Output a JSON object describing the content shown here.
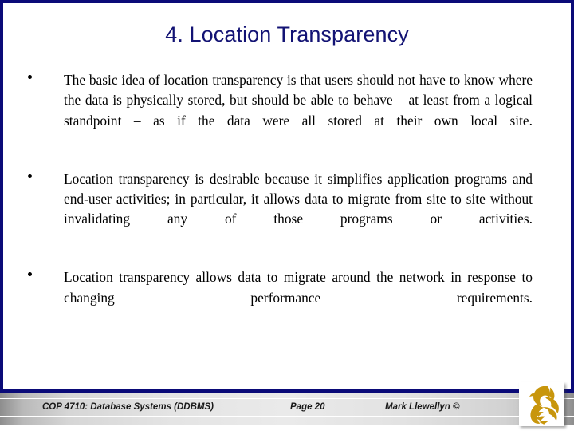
{
  "slide": {
    "title": "4. Location Transparency",
    "border_color": "#0a0a78",
    "title_color": "#131374",
    "background_color": "#ffffff"
  },
  "bullets": [
    {
      "marker": "bullet-dot",
      "text": "The basic idea of location transparency is that users should not have to know where the data is physically stored, but should be able to behave – at least from a logical standpoint – as if the data were all stored at their own local site."
    },
    {
      "marker": "bullet-dot",
      "text": "Location transparency is desirable because it simplifies application programs and end-user activities; in particular, it allows data to migrate from site to site without invalidating any of those programs or activities."
    },
    {
      "marker": "bullet-dot",
      "text": "Location transparency allows data to migrate around the network in response to changing performance requirements."
    }
  ],
  "footer": {
    "course": "COP 4710: Database Systems  (DDBMS)",
    "page": "Page 20",
    "author": "Mark Llewellyn ©"
  },
  "logo": {
    "name": "ucf-pegasus-logo",
    "color": "#c8960c"
  }
}
